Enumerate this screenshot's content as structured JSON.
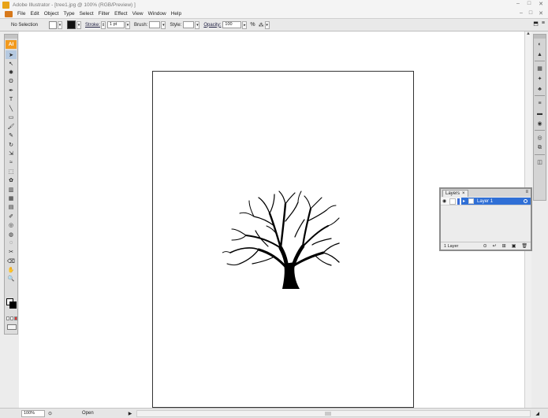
{
  "window": {
    "title": "Adobe Illustrator - [tree1.jpg @ 100% (RGB/Preview) ]",
    "controls": [
      "–",
      "□",
      "✕"
    ]
  },
  "menubar": {
    "items": [
      "File",
      "Edit",
      "Object",
      "Type",
      "Select",
      "Filter",
      "Effect",
      "View",
      "Window",
      "Help"
    ],
    "doc_controls": [
      "–",
      "□",
      "✕"
    ]
  },
  "controlbar": {
    "selection_label": "No Selection",
    "stroke_label": "Stroke:",
    "stroke_weight": "1 pt",
    "brush_label": "Brush:",
    "style_label": "Style:",
    "opacity_label": "Opacity:",
    "opacity_value": "100",
    "opacity_unit": "%"
  },
  "toolbox": {
    "logo": "AI",
    "tools": [
      "selection-tool",
      "direct-selection-tool",
      "magic-wand-tool",
      "lasso-tool",
      "pen-tool",
      "type-tool",
      "line-segment-tool",
      "rectangle-tool",
      "paintbrush-tool",
      "pencil-tool",
      "rotate-tool",
      "scale-tool",
      "warp-tool",
      "free-transform-tool",
      "symbol-sprayer-tool",
      "column-graph-tool",
      "mesh-tool",
      "gradient-tool",
      "eyedropper-tool",
      "blend-tool",
      "live-paint-bucket-tool",
      "live-paint-selection-tool",
      "slice-tool",
      "eraser-tool",
      "hand-tool",
      "zoom-tool"
    ],
    "tool_glyphs": [
      "➤",
      "↖",
      "✱",
      "ʘ",
      "✒",
      "T",
      "╲",
      "▭",
      "🖌",
      "✎",
      "↻",
      "⇲",
      "≈",
      "⬚",
      "✿",
      "▥",
      "▦",
      "▤",
      "✐",
      "◎",
      "◍",
      "◌",
      "✂",
      "⌫",
      "✋",
      "🔍"
    ]
  },
  "canvas": {
    "artwork": "tree-silhouette"
  },
  "dock": {
    "icons": [
      "color-icon",
      "color-guide-icon",
      "swatches-icon",
      "brushes-icon",
      "symbols-icon",
      "stroke-icon",
      "gradient-icon",
      "transparency-icon",
      "appearance-icon",
      "graphic-styles-icon",
      "layers-icon"
    ],
    "glyphs": [
      "◐",
      "▲",
      "▦",
      "✦",
      "♣",
      "≡",
      "▬",
      "◉",
      "◎",
      "⧉",
      "◫"
    ]
  },
  "layers_panel": {
    "tab_label": "Layers",
    "tab_close": "×",
    "menu_glyph": "≡",
    "layer_name": "Layer 1",
    "layer_count": "1 Layer",
    "footer_buttons": [
      "⊙",
      "↵",
      "⊞",
      "▣",
      "🗑"
    ]
  },
  "statusbar": {
    "zoom": "100%",
    "status": "Open",
    "nav_arrow": "▶",
    "corner": "◢"
  },
  "colors": {
    "accent": "#2f6fd6",
    "logo": "#f29a1e",
    "fill": "#ffffff",
    "stroke": "#000000"
  }
}
